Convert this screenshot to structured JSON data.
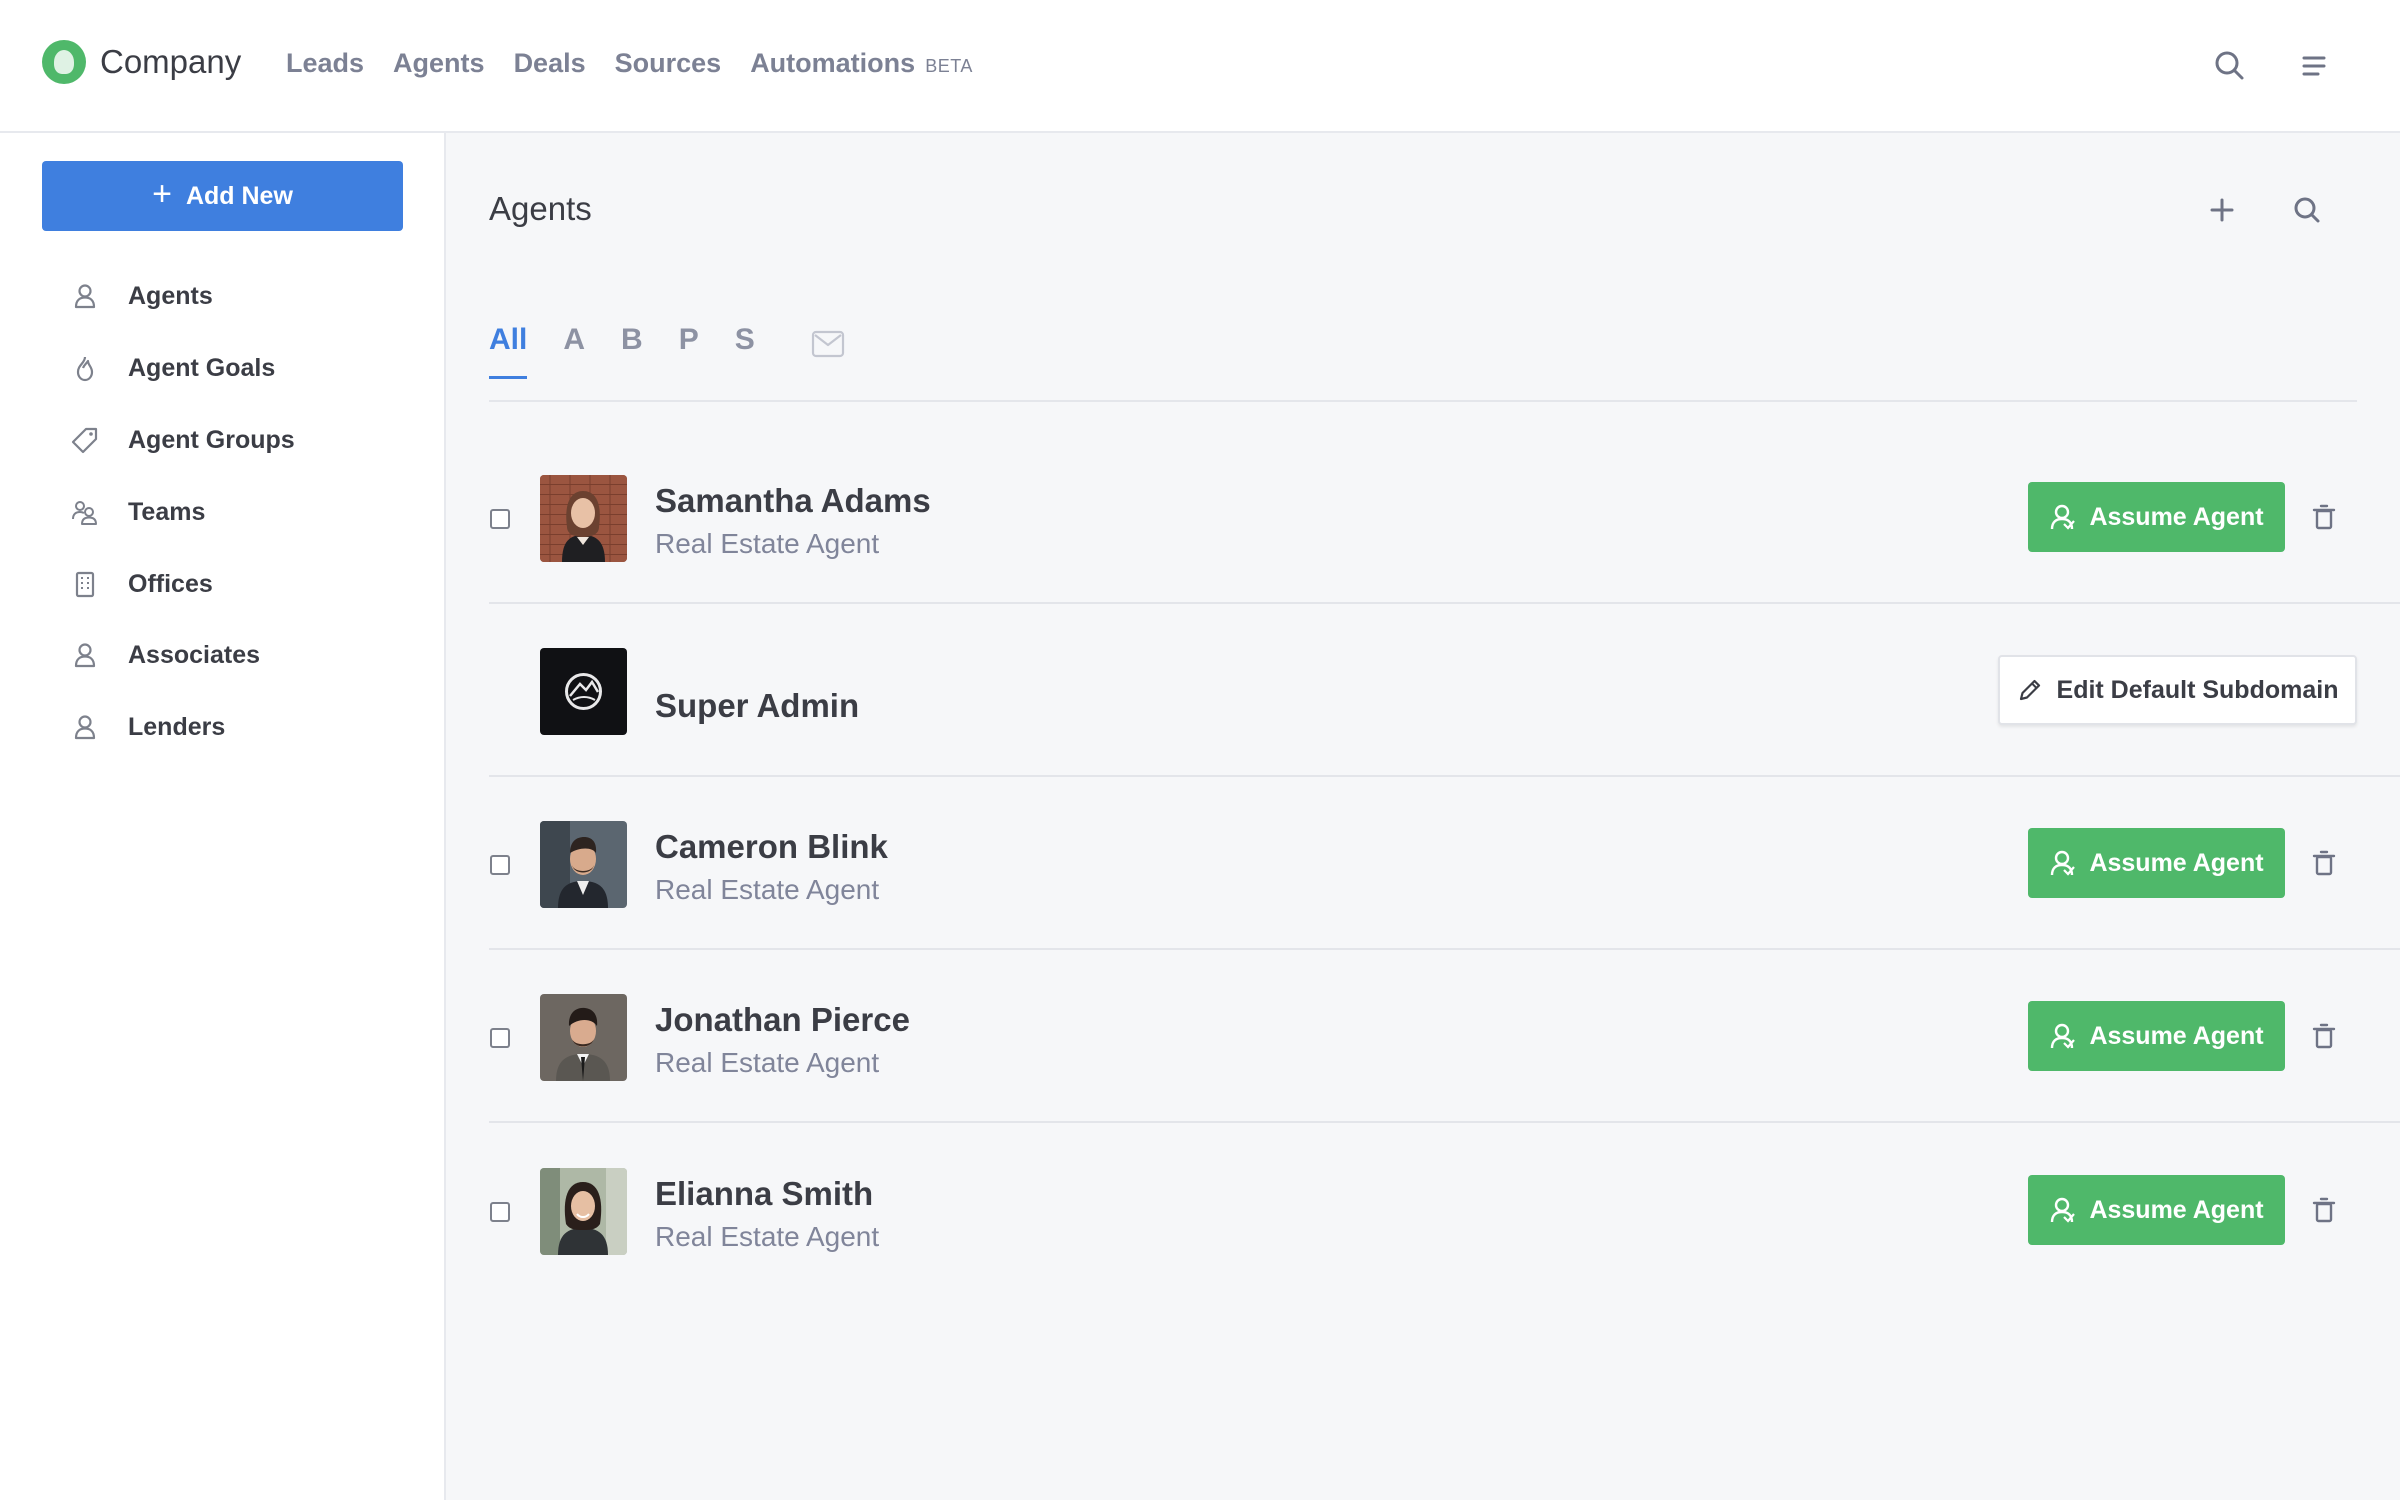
{
  "brand": {
    "name": "Company"
  },
  "topnav": {
    "items": [
      {
        "label": "Leads"
      },
      {
        "label": "Agents"
      },
      {
        "label": "Deals"
      },
      {
        "label": "Sources"
      },
      {
        "label": "Automations"
      }
    ],
    "beta_badge": "BETA",
    "icons": [
      "search-icon",
      "menu-icon"
    ]
  },
  "sidebar": {
    "add_button": "Add New",
    "items": [
      {
        "label": "Agents",
        "icon": "user-icon"
      },
      {
        "label": "Agent Goals",
        "icon": "flame-icon"
      },
      {
        "label": "Agent Groups",
        "icon": "tag-icon"
      },
      {
        "label": "Teams",
        "icon": "team-icon"
      },
      {
        "label": "Offices",
        "icon": "building-icon"
      },
      {
        "label": "Associates",
        "icon": "user-icon"
      },
      {
        "label": "Lenders",
        "icon": "user-icon"
      }
    ]
  },
  "main": {
    "title": "Agents",
    "tabs": [
      {
        "label": "All",
        "active": true
      },
      {
        "label": "A"
      },
      {
        "label": "B"
      },
      {
        "label": "P"
      },
      {
        "label": "S"
      }
    ],
    "rows": [
      {
        "name": "Samantha Adams",
        "role": "Real Estate Agent",
        "action": "Assume Agent"
      },
      {
        "name": "Super Admin",
        "action": "Edit Default Subdomain"
      },
      {
        "name": "Cameron Blink",
        "role": "Real Estate Agent",
        "action": "Assume Agent"
      },
      {
        "name": "Jonathan Pierce",
        "role": "Real Estate Agent",
        "action": "Assume Agent"
      },
      {
        "name": "Elianna Smith",
        "role": "Real Estate Agent",
        "action": "Assume Agent"
      }
    ]
  },
  "colors": {
    "accent_blue": "#3f7fdf",
    "assume_green": "#4fb86a",
    "text_dark": "#3b3d45",
    "text_muted": "#80859a"
  }
}
